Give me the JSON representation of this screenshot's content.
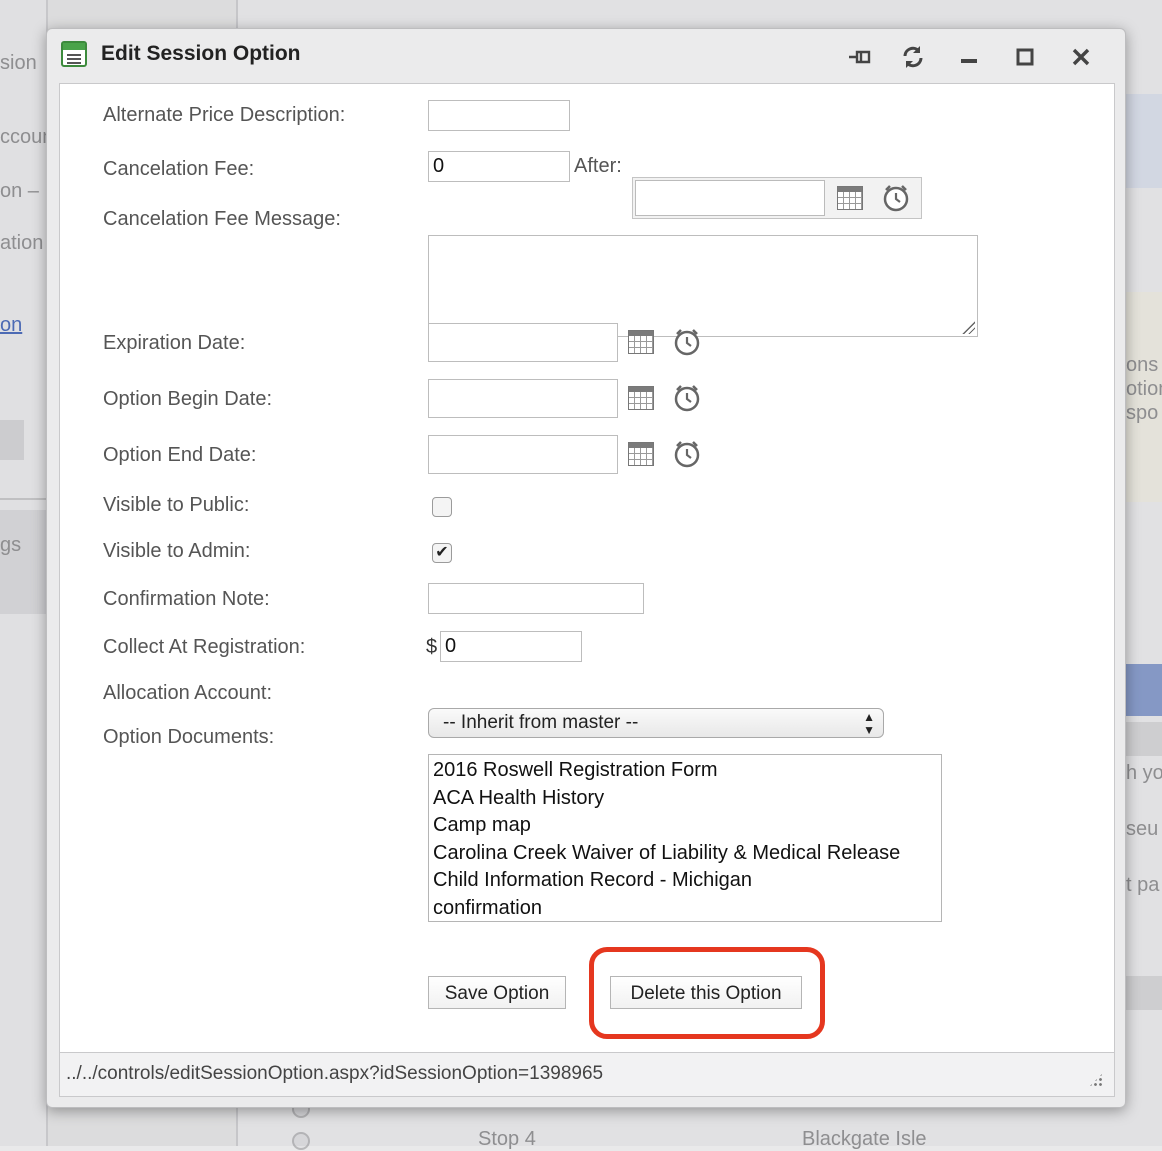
{
  "background": {
    "left_fragments": [
      "sion",
      "ccoun",
      "on –",
      "ation",
      "on",
      "gs"
    ],
    "right_fragments": [
      "ons",
      "otion",
      "spo",
      "h yo",
      "seu",
      "t pa"
    ],
    "bottom_fragments": [
      "Stop 4",
      "Blackgate Isle"
    ]
  },
  "dialog": {
    "title": "Edit Session Option",
    "title_icon": "window-icon",
    "controls": {
      "pin": "⊣",
      "reload": "⟳",
      "minimize": "▬",
      "maximize": "◻",
      "close": "✕"
    },
    "form": {
      "alternate_price_description": {
        "label": "Alternate Price Description:",
        "value": ""
      },
      "cancelation_fee": {
        "label": "Cancelation Fee:",
        "value": "0",
        "after_label": "After:",
        "after_value": ""
      },
      "cancelation_fee_message": {
        "label": "Cancelation Fee Message:",
        "value": ""
      },
      "expiration_date": {
        "label": "Expiration Date:",
        "value": ""
      },
      "option_begin_date": {
        "label": "Option Begin Date:",
        "value": ""
      },
      "option_end_date": {
        "label": "Option End Date:",
        "value": ""
      },
      "visible_to_public": {
        "label": "Visible to Public:",
        "checked": false
      },
      "visible_to_admin": {
        "label": "Visible to Admin:",
        "checked": true,
        "check_glyph": "✔"
      },
      "confirmation_note": {
        "label": "Confirmation Note:",
        "value": ""
      },
      "collect_at_registration": {
        "label": "Collect At Registration:",
        "currency": "$",
        "value": "0"
      },
      "allocation_account": {
        "label": "Allocation Account:",
        "selected": "-- Inherit from master --"
      },
      "option_documents": {
        "label": "Option Documents:",
        "items": [
          "2016 Roswell Registration Form",
          "ACA Health History",
          "Camp map",
          "Carolina Creek Waiver of Liability & Medical Release",
          "Child Information Record - Michigan",
          "confirmation"
        ]
      }
    },
    "buttons": {
      "save": "Save Option",
      "delete": "Delete this Option"
    },
    "highlight_color": "#e5371f",
    "status_url": "../../controls/editSessionOption.aspx?idSessionOption=1398965"
  }
}
